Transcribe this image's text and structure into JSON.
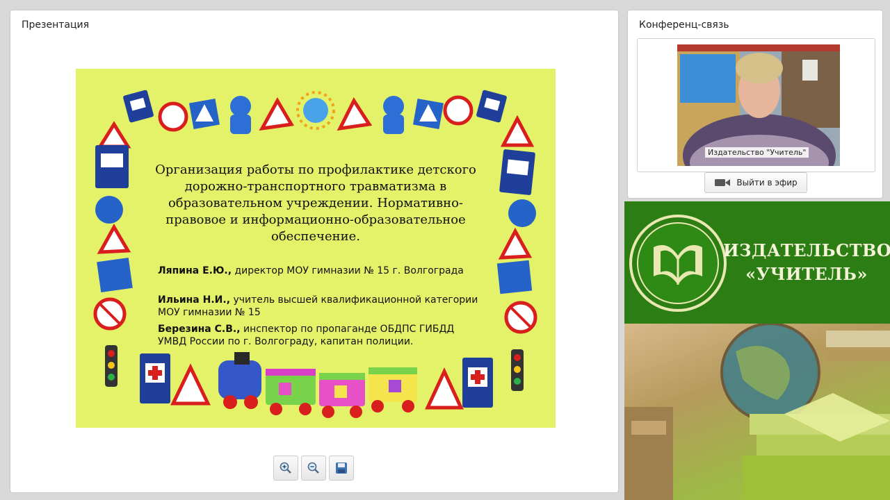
{
  "presentation": {
    "title": "Презентация",
    "slide": {
      "heading": "Организация работы по профилактике детского дорожно-транспортного травматизма в образовательном учреждении. Нормативно-правовое и информационно-образовательное обеспечение.",
      "authors": [
        {
          "name": "Ляпина Е.Ю.,",
          "role": "директор МОУ гимназии № 15 г. Волгограда"
        },
        {
          "name": "Ильина Н.И.,",
          "role": "учитель высшей квалификационной категории МОУ гимназии № 15"
        },
        {
          "name": "Березина С.В.,",
          "role": "инспектор по пропаганде ОБДПС ГИБДД УМВД России по г. Волгограду, капитан полиции."
        }
      ]
    },
    "toolbar": {
      "zoom_in_icon": "zoom-in-icon",
      "zoom_out_icon": "zoom-out-icon",
      "save_icon": "floppy-disk-icon"
    }
  },
  "conference": {
    "title": "Конференц-связь",
    "video_label": "Издательство \"Учитель\"",
    "go_live_label": "Выйти в эфир"
  },
  "publisher": {
    "name_line1": "ИЗДАТЕЛЬСТВО",
    "name_line2": "«УЧИТЕЛЬ»"
  },
  "colors": {
    "slide_bg": "#e4f26a",
    "publisher_green": "#2c7d13"
  }
}
